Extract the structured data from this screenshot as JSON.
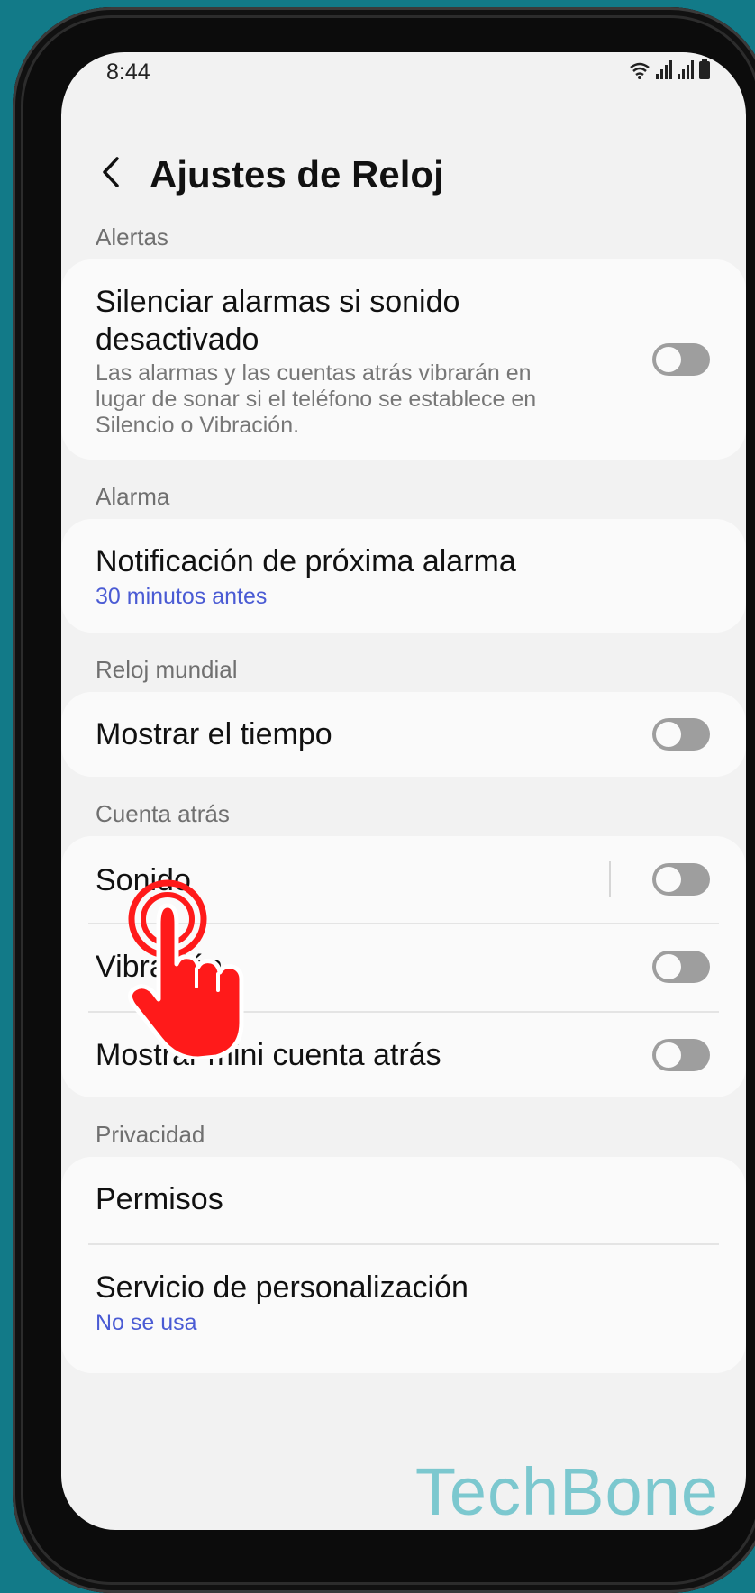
{
  "status_bar": {
    "time": "8:44"
  },
  "header": {
    "title": "Ajustes de Reloj"
  },
  "sections": {
    "alertas": {
      "label": "Alertas",
      "item": {
        "title_line1": "Silenciar alarmas si sonido",
        "title_line2": "desactivado",
        "desc_line1": "Las alarmas y las cuentas atrás vibrarán en",
        "desc_line2": "lugar de sonar si el teléfono se establece en",
        "desc_line3": "Silencio o Vibración.",
        "toggle": false
      }
    },
    "alarma": {
      "label": "Alarma",
      "item": {
        "title": "Notificación de próxima alarma",
        "value": "30 minutos antes"
      }
    },
    "reloj_mundial": {
      "label": "Reloj mundial",
      "item": {
        "title": "Mostrar el tiempo",
        "toggle": false
      }
    },
    "cuenta_atras": {
      "label": "Cuenta atrás",
      "items": [
        {
          "title": "Sonido",
          "toggle": false
        },
        {
          "title": "Vibración",
          "toggle": false
        },
        {
          "title": "Mostrar mini cuenta atrás",
          "toggle": false
        }
      ]
    },
    "privacidad": {
      "label": "Privacidad",
      "items": [
        {
          "title": "Permisos"
        },
        {
          "title": "Servicio de personalización",
          "value": "No se usa"
        }
      ]
    }
  },
  "watermark": "TechBone",
  "colors": {
    "background": "#127a88",
    "accent_blue": "#4a5bd4",
    "hand": "#ff1a1a",
    "watermark": "#7cc8cf"
  }
}
